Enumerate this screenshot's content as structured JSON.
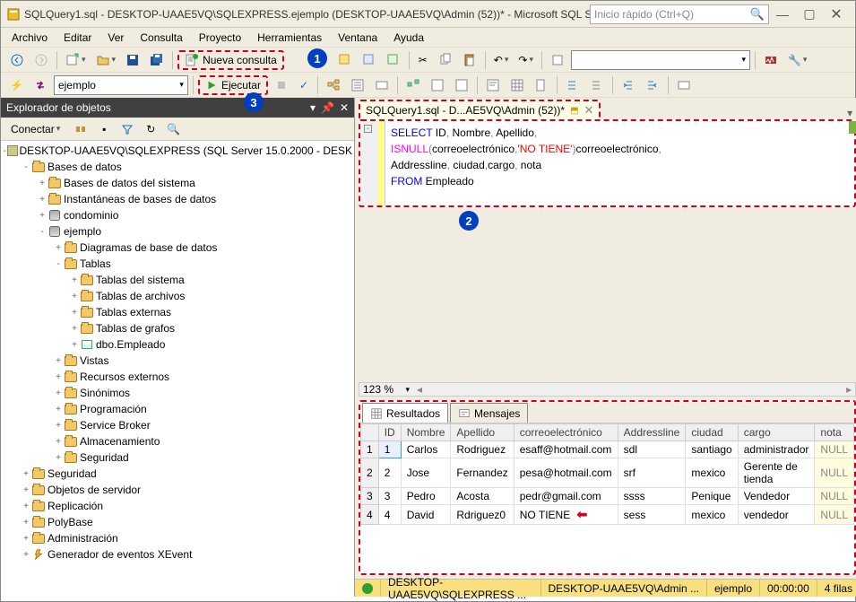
{
  "title": "SQLQuery1.sql - DESKTOP-UAAE5VQ\\SQLEXPRESS.ejemplo (DESKTOP-UAAE5VQ\\Admin (52))* - Microsoft SQL Ser...",
  "quick_launch_placeholder": "Inicio rápido (Ctrl+Q)",
  "menu": [
    "Archivo",
    "Editar",
    "Ver",
    "Consulta",
    "Proyecto",
    "Herramientas",
    "Ventana",
    "Ayuda"
  ],
  "toolbar1": {
    "nueva_consulta": "Nueva consulta"
  },
  "toolbar2": {
    "db_combo": "ejemplo",
    "ejecutar": "Ejecutar"
  },
  "explorer": {
    "title": "Explorador de objetos",
    "conectar": "Conectar",
    "root": "DESKTOP-UAAE5VQ\\SQLEXPRESS (SQL Server 15.0.2000 - DESK",
    "nodes": [
      {
        "d": 1,
        "tw": "-",
        "ic": "folder",
        "lbl": "Bases de datos"
      },
      {
        "d": 2,
        "tw": "+",
        "ic": "folder",
        "lbl": "Bases de datos del sistema"
      },
      {
        "d": 2,
        "tw": "+",
        "ic": "folder",
        "lbl": "Instantáneas de bases de datos"
      },
      {
        "d": 2,
        "tw": "+",
        "ic": "db",
        "lbl": "condominio"
      },
      {
        "d": 2,
        "tw": "-",
        "ic": "db",
        "lbl": "ejemplo"
      },
      {
        "d": 3,
        "tw": "+",
        "ic": "folder",
        "lbl": "Diagramas de base de datos"
      },
      {
        "d": 3,
        "tw": "-",
        "ic": "folder",
        "lbl": "Tablas"
      },
      {
        "d": 4,
        "tw": "+",
        "ic": "folder",
        "lbl": "Tablas del sistema"
      },
      {
        "d": 4,
        "tw": "+",
        "ic": "folder",
        "lbl": "Tablas de archivos"
      },
      {
        "d": 4,
        "tw": "+",
        "ic": "folder",
        "lbl": "Tablas externas"
      },
      {
        "d": 4,
        "tw": "+",
        "ic": "folder",
        "lbl": "Tablas de grafos"
      },
      {
        "d": 4,
        "tw": "+",
        "ic": "tbl",
        "lbl": "dbo.Empleado"
      },
      {
        "d": 3,
        "tw": "+",
        "ic": "folder",
        "lbl": "Vistas"
      },
      {
        "d": 3,
        "tw": "+",
        "ic": "folder",
        "lbl": "Recursos externos"
      },
      {
        "d": 3,
        "tw": "+",
        "ic": "folder",
        "lbl": "Sinónimos"
      },
      {
        "d": 3,
        "tw": "+",
        "ic": "folder",
        "lbl": "Programación"
      },
      {
        "d": 3,
        "tw": "+",
        "ic": "folder",
        "lbl": "Service Broker"
      },
      {
        "d": 3,
        "tw": "+",
        "ic": "folder",
        "lbl": "Almacenamiento"
      },
      {
        "d": 3,
        "tw": "+",
        "ic": "folder",
        "lbl": "Seguridad"
      },
      {
        "d": 1,
        "tw": "+",
        "ic": "folder",
        "lbl": "Seguridad"
      },
      {
        "d": 1,
        "tw": "+",
        "ic": "folder",
        "lbl": "Objetos de servidor"
      },
      {
        "d": 1,
        "tw": "+",
        "ic": "folder",
        "lbl": "Replicación"
      },
      {
        "d": 1,
        "tw": "+",
        "ic": "folder",
        "lbl": "PolyBase"
      },
      {
        "d": 1,
        "tw": "+",
        "ic": "folder",
        "lbl": "Administración"
      },
      {
        "d": 1,
        "tw": "+",
        "ic": "xev",
        "lbl": "Generador de eventos XEvent"
      }
    ]
  },
  "editor_tab": "SQLQuery1.sql - D...AE5VQ\\Admin (52))*",
  "sql": {
    "line1a": "SELECT",
    "line1b": " ID",
    "line1c": " Nombre",
    "line1d": " Apellido",
    "line2a": "ISNULL",
    "line2b": "correoelectrónico",
    "line2c": "'NO TIENE'",
    "line2d": "correoelectrónico",
    "line3": "Addressline",
    "line3b": " ciudad",
    "line3c": "cargo",
    "line3d": " nota",
    "line4a": "FROM",
    "line4b": " Empleado"
  },
  "zoom": "123 %",
  "results": {
    "tab_resultados": "Resultados",
    "tab_mensajes": "Mensajes",
    "columns": [
      "ID",
      "Nombre",
      "Apellido",
      "correoelectrónico",
      "Addressline",
      "ciudad",
      "cargo",
      "nota"
    ],
    "rows": [
      {
        "n": "1",
        "ID": "1",
        "Nombre": "Carlos",
        "Apellido": "Rodriguez",
        "correo": "esaff@hotmail.com",
        "Addr": "sdl",
        "ciudad": "santiago",
        "cargo": "administrador",
        "nota": "NULL"
      },
      {
        "n": "2",
        "ID": "2",
        "Nombre": "Jose",
        "Apellido": "Fernandez",
        "correo": "pesa@hotmail.com",
        "Addr": "srf",
        "ciudad": "mexico",
        "cargo": "Gerente de tienda",
        "nota": "NULL"
      },
      {
        "n": "3",
        "ID": "3",
        "Nombre": "Pedro",
        "Apellido": "Acosta",
        "correo": "pedr@gmail.com",
        "Addr": "ssss",
        "ciudad": "Penique",
        "cargo": "Vendedor",
        "nota": "NULL"
      },
      {
        "n": "4",
        "ID": "4",
        "Nombre": "David",
        "Apellido": "Rdriguez0",
        "correo": "NO TIENE",
        "Addr": "sess",
        "ciudad": "mexico",
        "cargo": "vendedor",
        "nota": "NULL"
      }
    ]
  },
  "status": {
    "server": "DESKTOP-UAAE5VQ\\SQLEXPRESS ...",
    "user": "DESKTOP-UAAE5VQ\\Admin ...",
    "db": "ejemplo",
    "time": "00:00:00",
    "rows": "4 filas"
  },
  "callouts": {
    "c1": "1",
    "c2": "2",
    "c3": "3"
  }
}
